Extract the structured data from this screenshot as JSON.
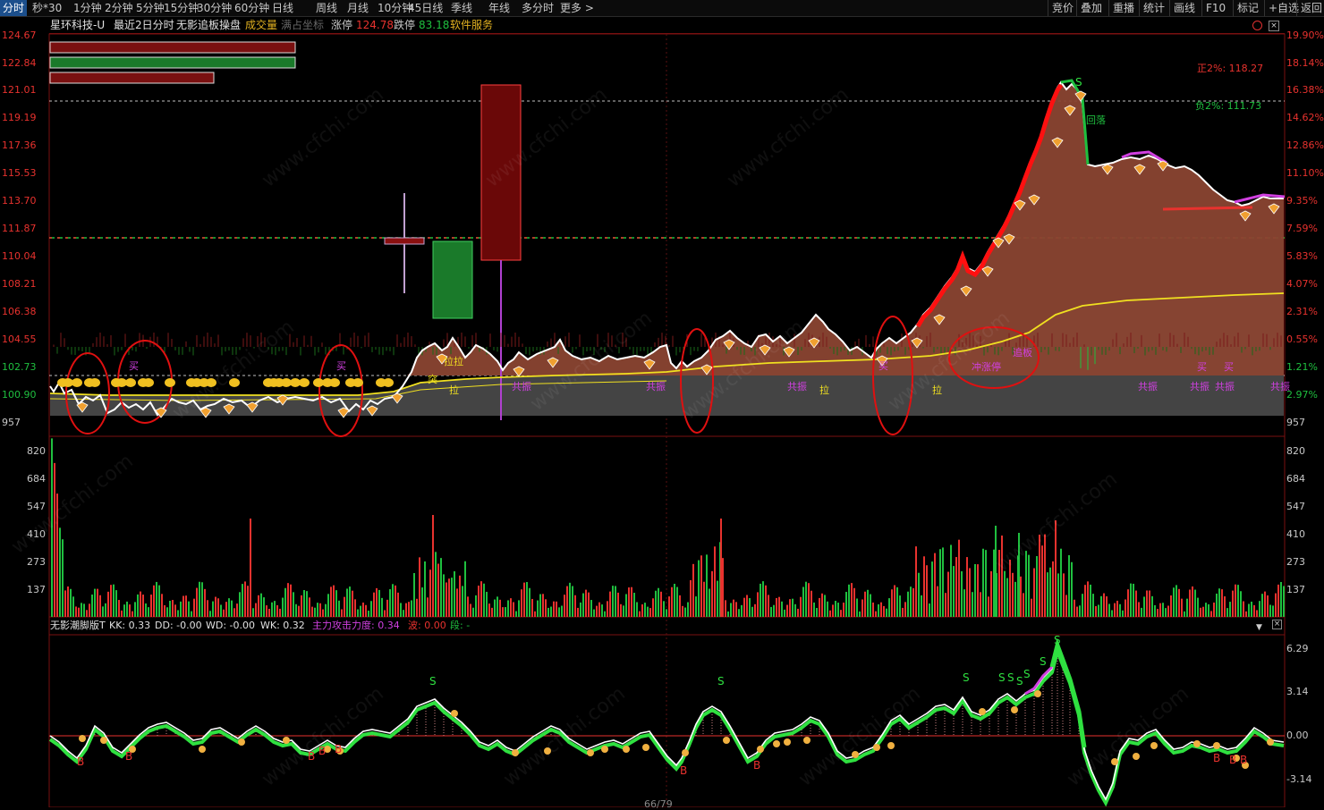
{
  "toolbar": {
    "timeframes": [
      "分时",
      "秒*30",
      "1分钟",
      "2分钟",
      "5分钟",
      "15分钟",
      "30分钟",
      "60分钟",
      "日线",
      "周线",
      "月线",
      "10分钟",
      "45日线",
      "季线",
      "年线",
      "多分时",
      "更多 >"
    ],
    "active": "分时",
    "right_buttons": [
      "竞价",
      "叠加",
      "重播",
      "统计",
      "画线",
      "F10",
      "标记",
      "+自选",
      "返回"
    ]
  },
  "infobar": {
    "stock": "星环科技-U",
    "mode": "最近2日分时",
    "indicator": "无影追板操盘",
    "volume_label": "成交量",
    "coord_label": "满占坐标",
    "limit_up_label": "涨停",
    "limit_up_value": "124.78",
    "limit_down_label": "跌停",
    "limit_down_value": "83.18",
    "service": "软件服务"
  },
  "price_axis": {
    "left": [
      "124.67",
      "122.84",
      "121.01",
      "119.19",
      "117.36",
      "115.53",
      "113.70",
      "111.87",
      "110.04",
      "108.21",
      "106.38",
      "104.55",
      "102.73",
      "100.90",
      "957"
    ],
    "right": [
      "19.90%",
      "18.14%",
      "16.38%",
      "14.62%",
      "12.86%",
      "11.10%",
      "9.35%",
      "7.59%",
      "5.83%",
      "4.07%",
      "2.31%",
      "0.55%",
      "1.21%",
      "2.97%",
      "957"
    ]
  },
  "volume_axis": {
    "left": [
      "820",
      "684",
      "547",
      "410",
      "273",
      "137"
    ],
    "right": [
      "820",
      "684",
      "547",
      "410",
      "273",
      "137"
    ]
  },
  "annotations": {
    "zheng": "正2%: 118.27",
    "fu": "负2%: 111.73",
    "huiluo": "回落",
    "buy": "买",
    "gongzhen": "共振",
    "la": "拉",
    "zhuiban": "追板",
    "zhongzhangting": "冲涨停",
    "hualaa": "拉拉",
    "tu": "突",
    "s_mark": "S",
    "b_mark": "B"
  },
  "indicator_bar": {
    "name": "无影潮脚版T",
    "kk": "KK: 0.33",
    "dd": "DD: -0.00",
    "wd": "WD: -0.00",
    "wk": "WK: 0.32",
    "force": "主力攻击力度: 0.34",
    "bo": "波: 0.00",
    "duan": "段: -"
  },
  "indicator_axis": [
    "6.29",
    "3.14",
    "0.00",
    "-3.14"
  ],
  "footer": {
    "page": "66/79"
  },
  "colors": {
    "up": "#e8322e",
    "down": "#1fbf3f",
    "price_line": "#ffffff",
    "avg_line": "#f0e020",
    "accent": "#1c4f8c"
  },
  "watermark": "www.cfchi.com"
}
